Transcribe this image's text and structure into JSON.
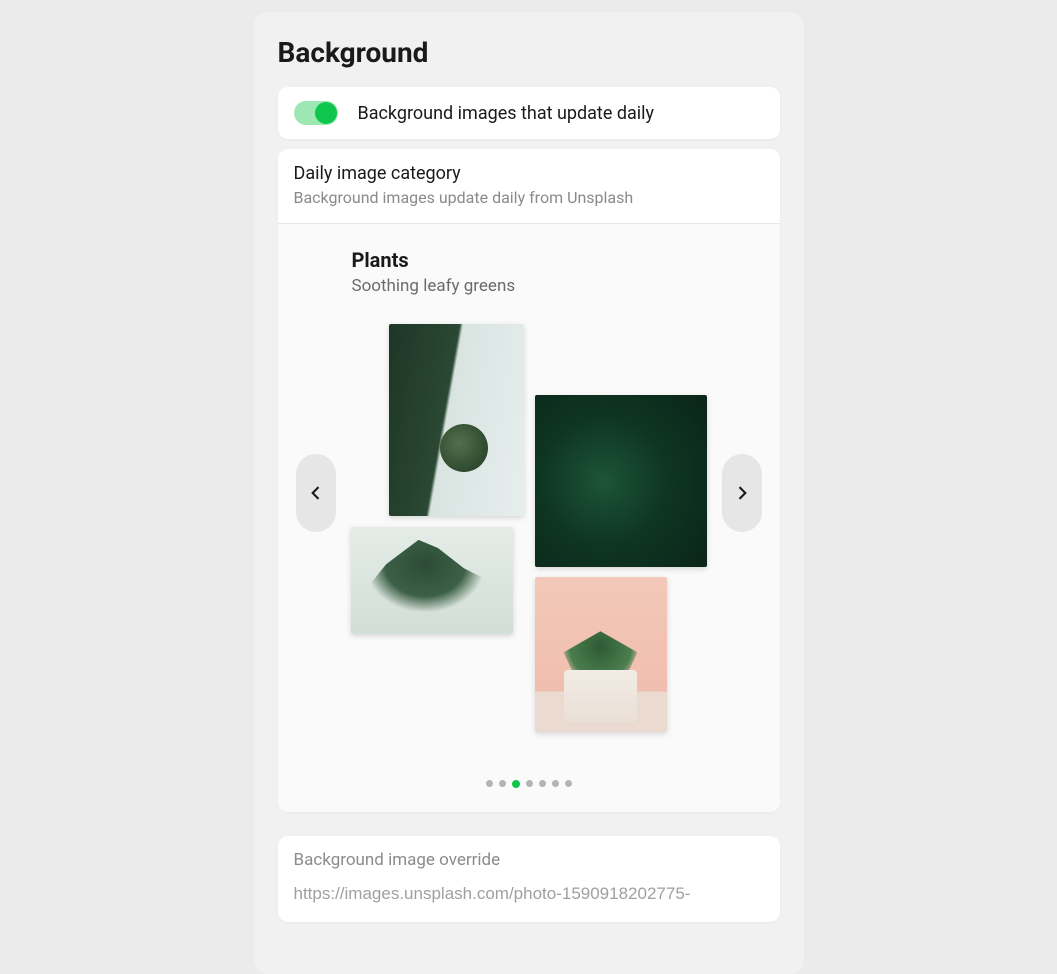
{
  "title": "Background",
  "daily_toggle": {
    "label": "Background images that update daily",
    "on": true
  },
  "category_section": {
    "title": "Daily image category",
    "subtitle": "Background images update daily from Unsplash"
  },
  "category": {
    "name": "Plants",
    "description": "Soothing leafy greens"
  },
  "pager": {
    "count": 7,
    "active_index": 2
  },
  "override": {
    "title": "Background image override",
    "value": "https://images.unsplash.com/photo-1590918202775-"
  }
}
